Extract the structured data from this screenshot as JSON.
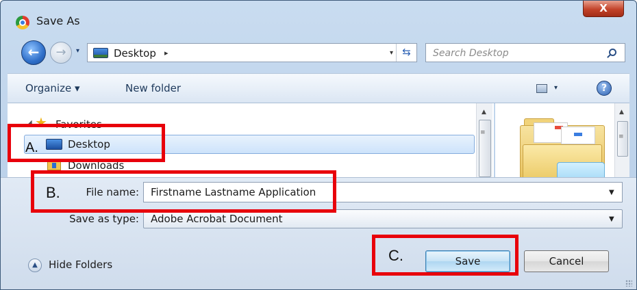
{
  "window": {
    "title": "Save As",
    "close_glyph": "X"
  },
  "nav": {
    "back_glyph": "←",
    "forward_glyph": "→",
    "dropdown_glyph": "▾"
  },
  "address": {
    "location": "Desktop",
    "arrow_glyph": "▸",
    "dropdown_glyph": "▾",
    "refresh_glyph": "⇆"
  },
  "search": {
    "placeholder": "Search Desktop"
  },
  "toolbar": {
    "organize_label": "Organize ▾",
    "new_folder_label": "New folder",
    "view_dropdown_glyph": "▾",
    "help_glyph": "?"
  },
  "navpane": {
    "favorites_label": "Favorites",
    "collapse_glyph": "◢",
    "star_glyph": "★",
    "items": [
      {
        "label": "Desktop",
        "selected": true
      },
      {
        "label": "Downloads",
        "selected": false
      }
    ],
    "scroll_up_glyph": "▲",
    "scroll_grip_glyph": "≡"
  },
  "content": {
    "scroll_up_glyph": "▲",
    "scroll_grip_glyph": "≡"
  },
  "form": {
    "file_name_label": "File name:",
    "file_name_value": "Firstname Lastname Application",
    "file_name_dropdown_glyph": "▼",
    "save_type_label": "Save as type:",
    "save_type_value": "Adobe Acrobat Document",
    "save_type_dropdown_glyph": "▼"
  },
  "footer": {
    "hide_folders_label": "Hide Folders",
    "hide_glyph": "▲",
    "save_label": "Save",
    "cancel_label": "Cancel"
  },
  "annotations": {
    "a": "A.",
    "b": "B.",
    "c": "C.",
    "color": "#e8000b"
  },
  "colors": {
    "title_bar": "#c9dcf0",
    "selection": "#cde3fb",
    "save_button": "#aed6f1"
  }
}
